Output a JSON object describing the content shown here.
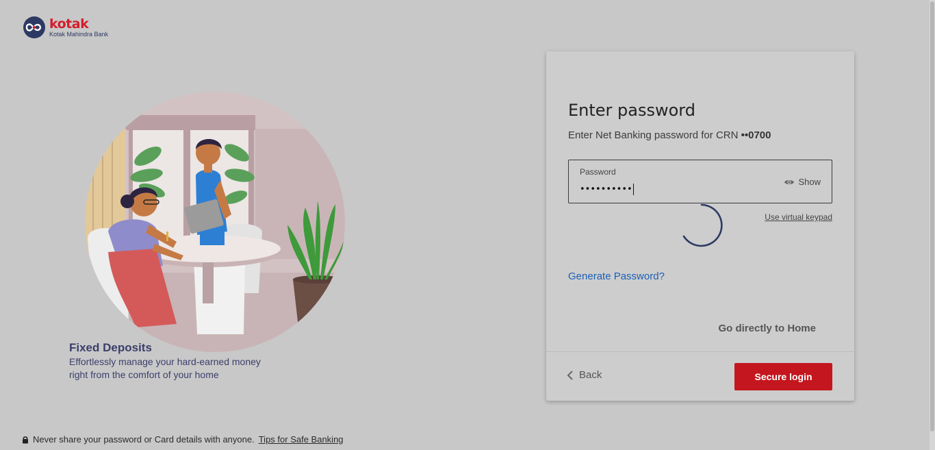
{
  "brand": {
    "name": "kotak",
    "subtitle": "Kotak Mahindra Bank",
    "primary_color": "#d31e2a",
    "navy_color": "#2c3a63"
  },
  "promo": {
    "title": "Fixed Deposits",
    "line1": "Effortlessly manage your hard-earned money",
    "line2": "right from the comfort of your home"
  },
  "footer": {
    "notice": "Never share your password or Card details with anyone.",
    "tips_link": "Tips for Safe Banking",
    "icon": "lock-icon"
  },
  "login_card": {
    "title": "Enter password",
    "subtitle_prefix": "Enter Net Banking password for CRN ",
    "crn_masked": "••0700",
    "password_field": {
      "label": "Password",
      "value_masked": "••••••••••",
      "show_label": "Show",
      "show_icon": "eye-icon"
    },
    "virtual_keypad_link": "Use virtual keypad",
    "generate_password_link": "Generate Password?",
    "home_link": "Go directly to Home",
    "back_label": "Back",
    "back_icon": "chevron-left-icon",
    "submit_label": "Secure login",
    "submit_color": "#c4161e",
    "link_color": "#1b5fb5"
  }
}
